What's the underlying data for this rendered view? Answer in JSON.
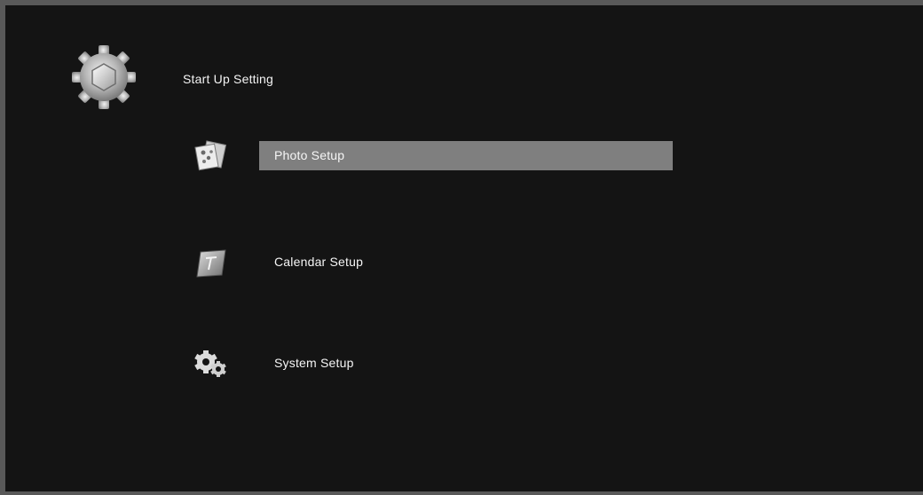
{
  "header": {
    "title": "Start Up Setting",
    "icon": "gear-icon"
  },
  "menu": {
    "selected_index": 0,
    "items": [
      {
        "label": "Photo Setup",
        "icon": "photo-icon"
      },
      {
        "label": "Calendar Setup",
        "icon": "calendar-icon"
      },
      {
        "label": "System Setup",
        "icon": "system-gears-icon"
      }
    ]
  },
  "colors": {
    "background": "#141414",
    "frame": "#595959",
    "highlight": "#7f7f7f",
    "text": "#f2f2f2"
  }
}
